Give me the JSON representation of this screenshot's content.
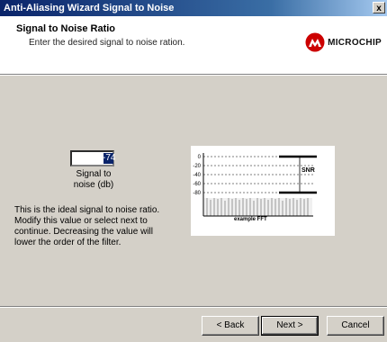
{
  "window": {
    "title": "Anti-Aliasing Wizard Signal to Noise",
    "close_glyph": "x"
  },
  "header": {
    "title": "Signal to Noise Ratio",
    "subtitle": "Enter the desired signal to noise ration.",
    "logo_text": "MICROCHIP"
  },
  "form": {
    "snr_value": "-74",
    "snr_label_line1": "Signal to",
    "snr_label_line2": "noise (db)",
    "description": "This is the ideal signal to noise ratio.  Modify this value or select next to continue. Decreasing the value will lower the order of the filter."
  },
  "fft": {
    "caption": "example FFT",
    "snr_tag": "SNR",
    "y_ticks": [
      "0",
      "-20",
      "-40",
      "-60",
      "-80"
    ]
  },
  "buttons": {
    "back": "< Back",
    "next": "Next >",
    "cancel": "Cancel"
  },
  "colors": {
    "titlebar_start": "#0a246a",
    "logo_red": "#cc0000",
    "dialog_face": "#d4d0c8"
  }
}
